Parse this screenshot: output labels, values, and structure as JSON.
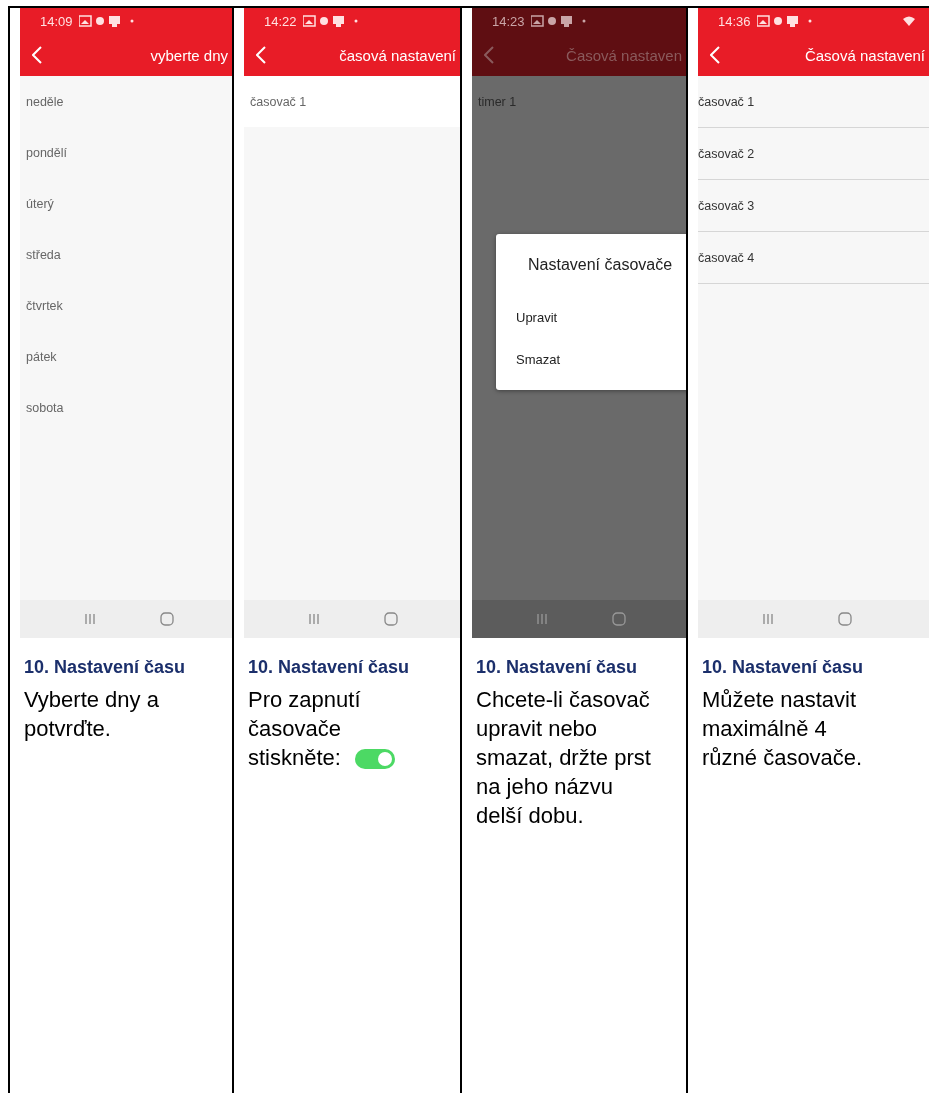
{
  "columns": [
    {
      "phone": {
        "time": "14:09",
        "title": "vyberte dny",
        "dimmed": false,
        "wifi": false,
        "dividers": false,
        "items": [
          "neděle",
          "pondělí",
          "úterý",
          "středa",
          "čtvrtek",
          "pátek",
          "sobota"
        ]
      },
      "heading": "10.  Nastavení času",
      "body": "Vyberte dny a potvrďte."
    },
    {
      "phone": {
        "time": "14:22",
        "title": "časová nastavení",
        "dimmed": false,
        "wifi": false,
        "dividers": false,
        "items": [
          "časovač 1"
        ]
      },
      "heading": "10. Nastavení času",
      "body": "Pro zapnutí časovače stiskněte:",
      "toggle": {
        "on": true
      }
    },
    {
      "phone": {
        "time": "14:23",
        "title": "Časová nastaven",
        "dimmed": true,
        "wifi": false,
        "dividers": false,
        "items": [
          "timer 1"
        ],
        "dialog": {
          "title": "Nastavení časovače",
          "options": [
            "Upravit",
            "Smazat"
          ]
        }
      },
      "heading": "10. Nastavení času",
      "body": "Chcete-li časovač upravit nebo smazat, držte prst na jeho názvu delší dobu."
    },
    {
      "phone": {
        "time": "14:36",
        "title": "Časová nastavení",
        "dimmed": false,
        "wifi": true,
        "dividers": true,
        "items": [
          "časovač 1",
          "časovač 2",
          "časovač 3",
          "časovač 4"
        ]
      },
      "heading": "10. Nastavení času",
      "body": "Můžete nastavit maximálně 4 různé časovače."
    }
  ]
}
